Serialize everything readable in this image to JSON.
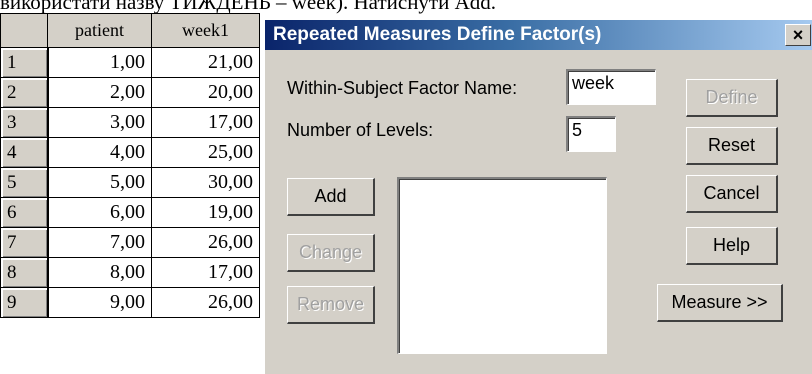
{
  "document": {
    "caption_fragment": "використати назву ТИЖДЕНЬ – week). Натиснути Add."
  },
  "spreadsheet": {
    "columns": [
      "patient",
      "week1"
    ],
    "rows": [
      {
        "num": "1",
        "patient": "1,00",
        "week1": "21,00"
      },
      {
        "num": "2",
        "patient": "2,00",
        "week1": "20,00"
      },
      {
        "num": "3",
        "patient": "3,00",
        "week1": "17,00"
      },
      {
        "num": "4",
        "patient": "4,00",
        "week1": "25,00"
      },
      {
        "num": "5",
        "patient": "5,00",
        "week1": "30,00"
      },
      {
        "num": "6",
        "patient": "6,00",
        "week1": "19,00"
      },
      {
        "num": "7",
        "patient": "7,00",
        "week1": "26,00"
      },
      {
        "num": "8",
        "patient": "8,00",
        "week1": "17,00"
      },
      {
        "num": "9",
        "patient": "9,00",
        "week1": "26,00"
      }
    ]
  },
  "dialog": {
    "title": "Repeated Measures Define Factor(s)",
    "close_label": "×",
    "factor_name_label": "Within-Subject Factor Name:",
    "factor_name_value": "week",
    "levels_label": "Number of Levels:",
    "levels_value": "5",
    "buttons": {
      "define": "Define",
      "reset": "Reset",
      "cancel": "Cancel",
      "help": "Help",
      "measure": "Measure >>",
      "add": "Add",
      "change": "Change",
      "remove": "Remove"
    }
  }
}
